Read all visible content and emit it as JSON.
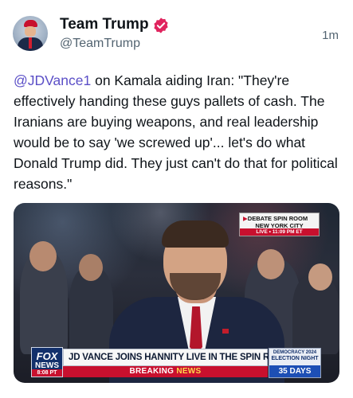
{
  "post": {
    "author_name": "Team Trump",
    "author_handle": "@TeamTrump",
    "timestamp": "1m",
    "mention": "@JDVance1",
    "body_text": " on Kamala aiding Iran: \"They're effectively handing these guys pallets of cash. The Iranians are buying weapons, and real leadership would be to say 'we screwed up'... let's do what Donald Trump did. They just can't do that for political reasons.\"",
    "verified_icon": "verified-badge-icon",
    "colors": {
      "mention": "#5b4fc7",
      "verified": "#e0245e"
    }
  },
  "media": {
    "corner_tag": {
      "line1": "DEBATE SPIN ROOM",
      "line2": "NEW YORK CITY",
      "line3": "LIVE • 11:09 PM ET"
    },
    "network_logo": {
      "top": "FOX",
      "bottom": "NEWS",
      "clock": "8:08 PT"
    },
    "headline": "JD VANCE JOINS HANNITY LIVE IN THE SPIN ROOM",
    "breaking_prefix": "BREAKING ",
    "breaking_suffix": "NEWS",
    "countdown": {
      "line1": "DEMOCRACY 2024",
      "line2": "ELECTION NIGHT",
      "days": "35 DAYS"
    },
    "colors": {
      "fox_blue": "#12306b",
      "breaking_red": "#c8102e"
    }
  }
}
